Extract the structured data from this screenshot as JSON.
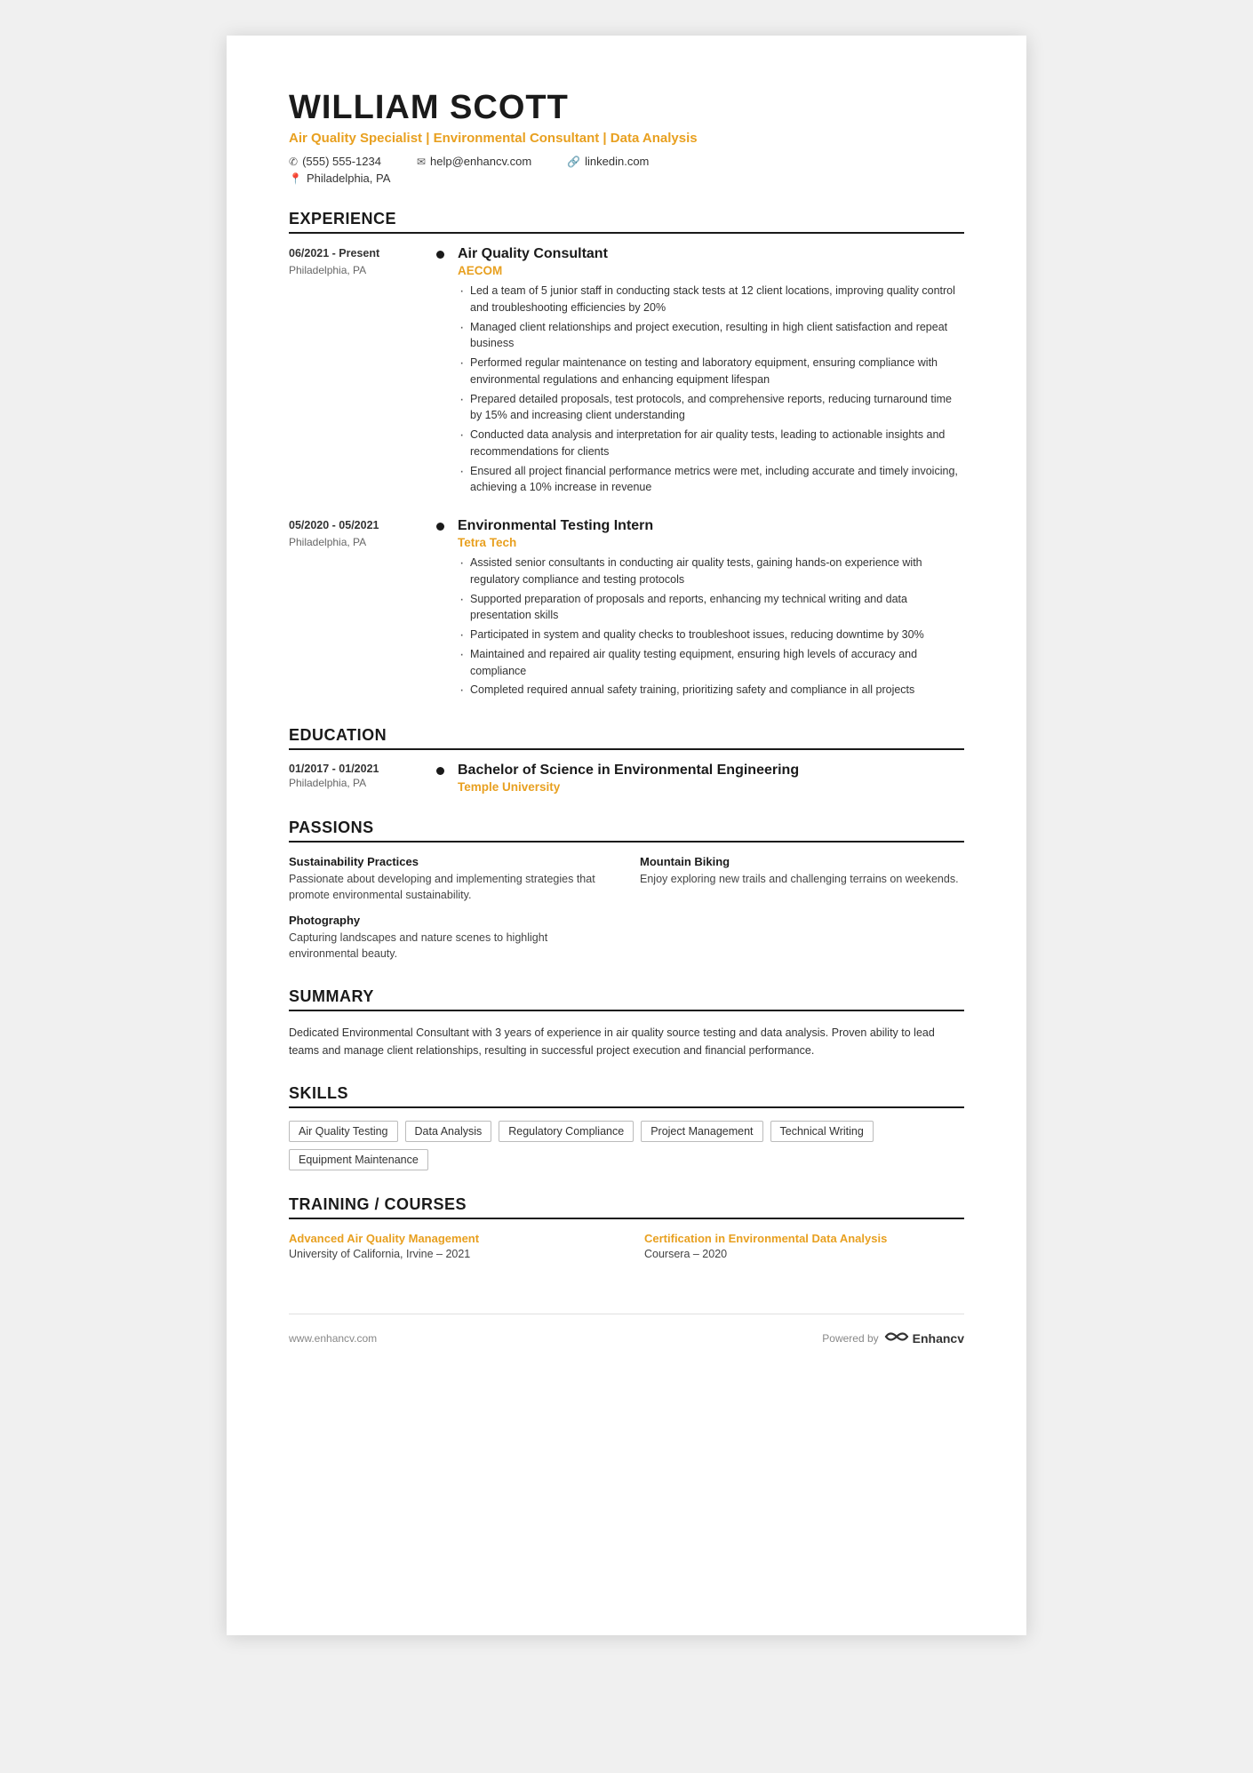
{
  "header": {
    "name": "WILLIAM SCOTT",
    "title": "Air Quality Specialist | Environmental Consultant | Data Analysis",
    "phone": "(555) 555-1234",
    "email": "help@enhancv.com",
    "linkedin": "linkedin.com",
    "location": "Philadelphia, PA"
  },
  "sections": {
    "experience": {
      "label": "EXPERIENCE",
      "items": [
        {
          "date": "06/2021 - Present",
          "location": "Philadelphia, PA",
          "role": "Air Quality Consultant",
          "company": "AECOM",
          "bullets": [
            "Led a team of 5 junior staff in conducting stack tests at 12 client locations, improving quality control and troubleshooting efficiencies by 20%",
            "Managed client relationships and project execution, resulting in high client satisfaction and repeat business",
            "Performed regular maintenance on testing and laboratory equipment, ensuring compliance with environmental regulations and enhancing equipment lifespan",
            "Prepared detailed proposals, test protocols, and comprehensive reports, reducing turnaround time by 15% and increasing client understanding",
            "Conducted data analysis and interpretation for air quality tests, leading to actionable insights and recommendations for clients",
            "Ensured all project financial performance metrics were met, including accurate and timely invoicing, achieving a 10% increase in revenue"
          ]
        },
        {
          "date": "05/2020 - 05/2021",
          "location": "Philadelphia, PA",
          "role": "Environmental Testing Intern",
          "company": "Tetra Tech",
          "bullets": [
            "Assisted senior consultants in conducting air quality tests, gaining hands-on experience with regulatory compliance and testing protocols",
            "Supported preparation of proposals and reports, enhancing my technical writing and data presentation skills",
            "Participated in system and quality checks to troubleshoot issues, reducing downtime by 30%",
            "Maintained and repaired air quality testing equipment, ensuring high levels of accuracy and compliance",
            "Completed required annual safety training, prioritizing safety and compliance in all projects"
          ]
        }
      ]
    },
    "education": {
      "label": "EDUCATION",
      "items": [
        {
          "date": "01/2017 - 01/2021",
          "location": "Philadelphia, PA",
          "degree": "Bachelor of Science in Environmental Engineering",
          "school": "Temple University"
        }
      ]
    },
    "passions": {
      "label": "PASSIONS",
      "items": [
        {
          "name": "Sustainability Practices",
          "description": "Passionate about developing and implementing strategies that promote environmental sustainability."
        },
        {
          "name": "Mountain Biking",
          "description": "Enjoy exploring new trails and challenging terrains on weekends."
        },
        {
          "name": "Photography",
          "description": "Capturing landscapes and nature scenes to highlight environmental beauty."
        }
      ]
    },
    "summary": {
      "label": "SUMMARY",
      "text": "Dedicated Environmental Consultant with 3 years of experience in air quality source testing and data analysis. Proven ability to lead teams and manage client relationships, resulting in successful project execution and financial performance."
    },
    "skills": {
      "label": "SKILLS",
      "items": [
        "Air Quality Testing",
        "Data Analysis",
        "Regulatory Compliance",
        "Project Management",
        "Technical Writing",
        "Equipment Maintenance"
      ]
    },
    "training": {
      "label": "TRAINING / COURSES",
      "items": [
        {
          "name": "Advanced Air Quality Management",
          "org": "University of California, Irvine – 2021"
        },
        {
          "name": "Certification in Environmental Data Analysis",
          "org": "Coursera – 2020"
        }
      ]
    }
  },
  "footer": {
    "url": "www.enhancv.com",
    "powered_by": "Powered by",
    "brand": "Enhancv"
  }
}
